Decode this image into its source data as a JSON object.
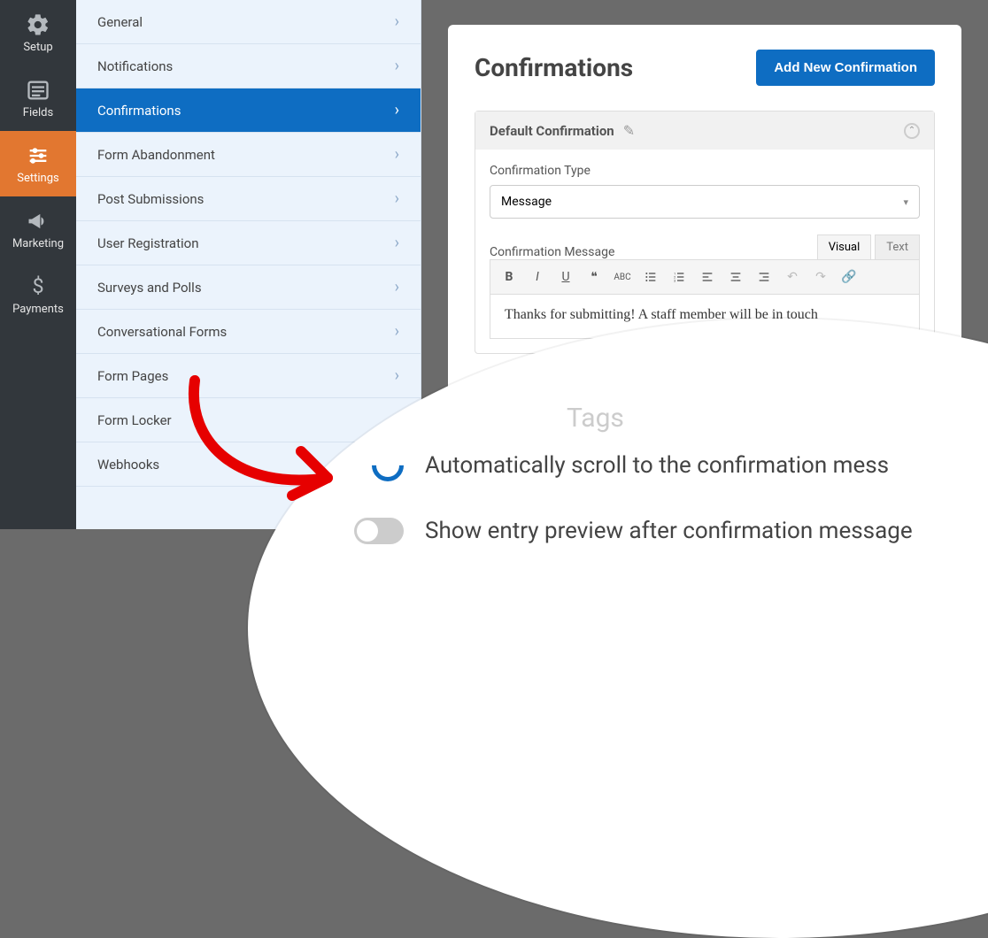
{
  "iconbar": {
    "items": [
      {
        "name": "setup",
        "label": "Setup"
      },
      {
        "name": "fields",
        "label": "Fields"
      },
      {
        "name": "settings",
        "label": "Settings"
      },
      {
        "name": "marketing",
        "label": "Marketing"
      },
      {
        "name": "payments",
        "label": "Payments"
      }
    ]
  },
  "sidebar": {
    "items": [
      {
        "label": "General"
      },
      {
        "label": "Notifications"
      },
      {
        "label": "Confirmations"
      },
      {
        "label": "Form Abandonment"
      },
      {
        "label": "Post Submissions"
      },
      {
        "label": "User Registration"
      },
      {
        "label": "Surveys and Polls"
      },
      {
        "label": "Conversational Forms"
      },
      {
        "label": "Form Pages"
      },
      {
        "label": "Form Locker"
      },
      {
        "label": "Webhooks"
      }
    ]
  },
  "panel": {
    "title": "Confirmations",
    "addButton": "Add New Confirmation"
  },
  "card": {
    "title": "Default Confirmation",
    "typeLabel": "Confirmation Type",
    "typeValue": "Message",
    "messageLabel": "Confirmation Message",
    "visualTab": "Visual",
    "textTab": "Text",
    "messageContent": "Thanks for submitting! A staff member will be in touch"
  },
  "zoom": {
    "ghost": "Tags",
    "scrollLabel": "Automatically scroll to the confirmation mess",
    "previewLabel": "Show entry preview after confirmation message"
  }
}
